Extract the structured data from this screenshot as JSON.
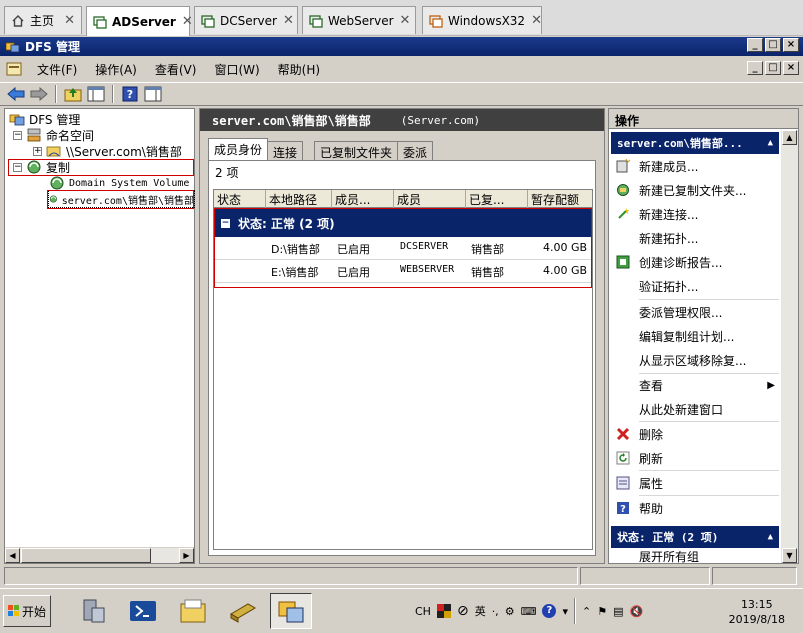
{
  "browser_tabs": [
    {
      "label": "主页",
      "icon": "home-icon",
      "active": false,
      "closable": true
    },
    {
      "label": "ADServer",
      "icon": "vm-icon",
      "active": true,
      "closable": true
    },
    {
      "label": "DCServer",
      "icon": "vm-icon",
      "active": false,
      "closable": true
    },
    {
      "label": "WebServer",
      "icon": "vm-icon",
      "active": false,
      "closable": true
    },
    {
      "label": "WindowsX32",
      "icon": "vm-icon",
      "active": false,
      "closable": true
    }
  ],
  "window": {
    "title": "DFS 管理",
    "controls": [
      "_",
      "□",
      "×"
    ]
  },
  "menubar": {
    "items": [
      "文件(F)",
      "操作(A)",
      "查看(V)",
      "窗口(W)",
      "帮助(H)"
    ],
    "child_controls": [
      "_",
      "□",
      "×"
    ]
  },
  "tree": {
    "nodes": [
      {
        "label": "DFS 管理",
        "icon": "dfs-icon",
        "expander": ""
      },
      {
        "label": "命名空间",
        "icon": "namespace-icon",
        "expander": "−"
      },
      {
        "label": "\\\\Server.com\\销售部",
        "icon": "folder-share-icon",
        "expander": "+"
      },
      {
        "label": "复制",
        "icon": "replication-icon",
        "expander": "−"
      },
      {
        "label": "Domain System Volume",
        "icon": "replication-group-icon",
        "expander": ""
      },
      {
        "label": "server.com\\销售部\\销售部",
        "icon": "replication-group-icon",
        "expander": ""
      }
    ]
  },
  "center": {
    "header": "server.com\\销售部\\销售部",
    "header_sub": "(Server.com)",
    "tabs": [
      "成员身份",
      "连接",
      "已复制文件夹",
      "委派"
    ],
    "count": "2 项",
    "columns": [
      "状态",
      "本地路径",
      "成员...",
      "成员",
      "已复...",
      "暂存配额"
    ],
    "group_label": "状态: 正常 (2 项)",
    "rows": [
      {
        "path": "D:\\销售部",
        "status": "已启用",
        "member": "DCSERVER",
        "rf": "销售部",
        "quota": "4.00 GB"
      },
      {
        "path": "E:\\销售部",
        "status": "已启用",
        "member": "WEBSERVER",
        "rf": "销售部",
        "quota": "4.00 GB"
      }
    ]
  },
  "actions": {
    "title": "操作",
    "section1": "server.com\\销售部...",
    "items": [
      {
        "label": "新建成员...",
        "icon": "new-member-icon"
      },
      {
        "label": "新建已复制文件夹...",
        "icon": "new-folder-icon"
      },
      {
        "label": "新建连接...",
        "icon": "new-connection-icon"
      },
      {
        "label": "新建拓扑...",
        "icon": ""
      },
      {
        "label": "创建诊断报告...",
        "icon": "report-icon"
      },
      {
        "label": "验证拓扑...",
        "icon": ""
      },
      {
        "label": "委派管理权限...",
        "icon": ""
      },
      {
        "label": "编辑复制组计划...",
        "icon": ""
      },
      {
        "label": "从显示区域移除复...",
        "icon": ""
      },
      {
        "label": "查看",
        "icon": "",
        "submenu": true
      },
      {
        "label": "从此处新建窗口",
        "icon": ""
      },
      {
        "label": "删除",
        "icon": "delete-icon"
      },
      {
        "label": "刷新",
        "icon": "refresh-icon"
      },
      {
        "label": "属性",
        "icon": "properties-icon"
      },
      {
        "label": "帮助",
        "icon": "help-icon"
      }
    ],
    "section2": "状态: 正常 (2 项)",
    "section2_item": "展开所有组"
  },
  "taskbar": {
    "start_label": "开始",
    "apps": [
      "server-manager-icon",
      "powershell-icon",
      "explorer-icon",
      "tools-icon",
      "dfs-management-icon"
    ],
    "tray_lang": "CH",
    "tray_ime": "英",
    "clock_time": "13:15",
    "clock_date": "2019/8/18"
  },
  "colors": {
    "accent": "#0a246a",
    "highlight_box": "#d00000",
    "chrome": "#d4d0c8"
  }
}
